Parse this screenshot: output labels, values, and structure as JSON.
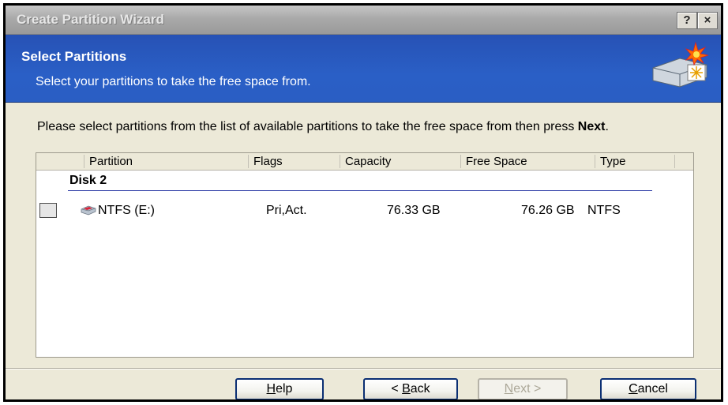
{
  "window": {
    "title": "Create Partition Wizard",
    "help_glyph": "?",
    "close_glyph": "×"
  },
  "header": {
    "title": "Select Partitions",
    "subtitle": "Select your partitions to take the free space from."
  },
  "instructions": {
    "text_before": "Please select partitions from the list of available partitions to take the free space from then press ",
    "emphasis": "Next",
    "text_after": "."
  },
  "list": {
    "columns": [
      "Partition",
      "Flags",
      "Capacity",
      "Free Space",
      "Type"
    ],
    "disk_label": "Disk 2",
    "rows": [
      {
        "checked": false,
        "partition": "NTFS (E:)",
        "flags": "Pri,Act.",
        "capacity": "76.33 GB",
        "free_space": "76.26 GB",
        "type": "NTFS",
        "icon": "drive-partition-icon"
      }
    ]
  },
  "buttons": {
    "help": {
      "underline": "H",
      "rest": "elp"
    },
    "back": {
      "prefix": "< ",
      "underline": "B",
      "rest": "ack"
    },
    "next": {
      "underline": "N",
      "rest": "ext >",
      "enabled": false
    },
    "cancel": {
      "underline": "C",
      "rest": "ancel"
    }
  },
  "colors": {
    "header_blue": "#2a5ec3",
    "titlebar_gray": "#a9a9a9",
    "dialog_face": "#ece9d8",
    "button_border": "#0b2f73"
  }
}
